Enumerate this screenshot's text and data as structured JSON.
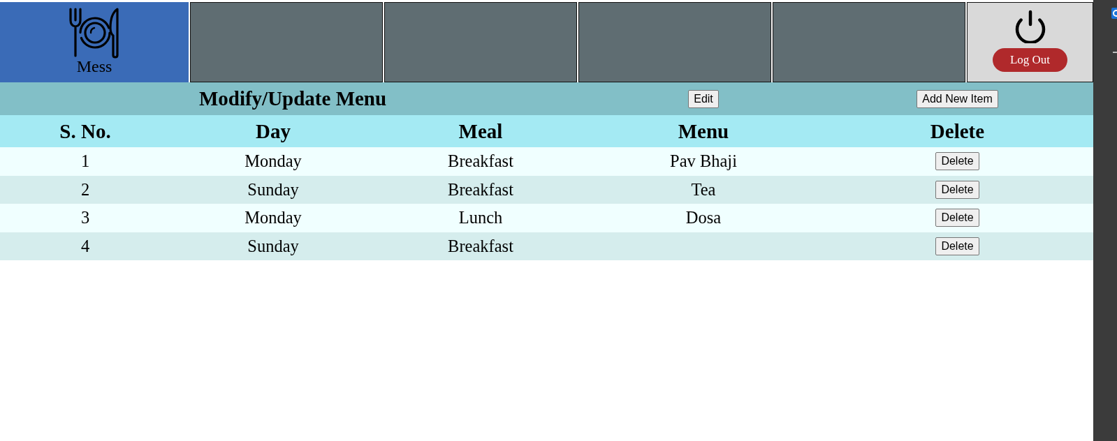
{
  "nav": {
    "tiles": [
      {
        "kind": "brand",
        "label": "Mess",
        "selected": true
      },
      {
        "kind": "empty",
        "selected": false
      },
      {
        "kind": "empty",
        "selected": false
      },
      {
        "kind": "empty",
        "selected": false
      },
      {
        "kind": "empty",
        "selected": false
      }
    ],
    "logout": {
      "label": "Log Out"
    }
  },
  "panel": {
    "title": "Modify/Update Menu",
    "actions": [
      {
        "label": "Edit"
      },
      {
        "label": "Add New Item"
      }
    ]
  },
  "table": {
    "columns": [
      "S. No.",
      "Day",
      "Meal",
      "Menu",
      "Delete"
    ],
    "rows": [
      {
        "s_no": "1",
        "day": "Monday",
        "meal": "Breakfast",
        "menu": "Pav Bhaji",
        "action": "Delete"
      },
      {
        "s_no": "2",
        "day": "Sunday",
        "meal": "Breakfast",
        "menu": "Tea",
        "action": "Delete"
      },
      {
        "s_no": "3",
        "day": "Monday",
        "meal": "Lunch",
        "menu": "Dosa",
        "action": "Delete"
      },
      {
        "s_no": "4",
        "day": "Sunday",
        "meal": "Breakfast",
        "action": "Delete"
      }
    ]
  }
}
